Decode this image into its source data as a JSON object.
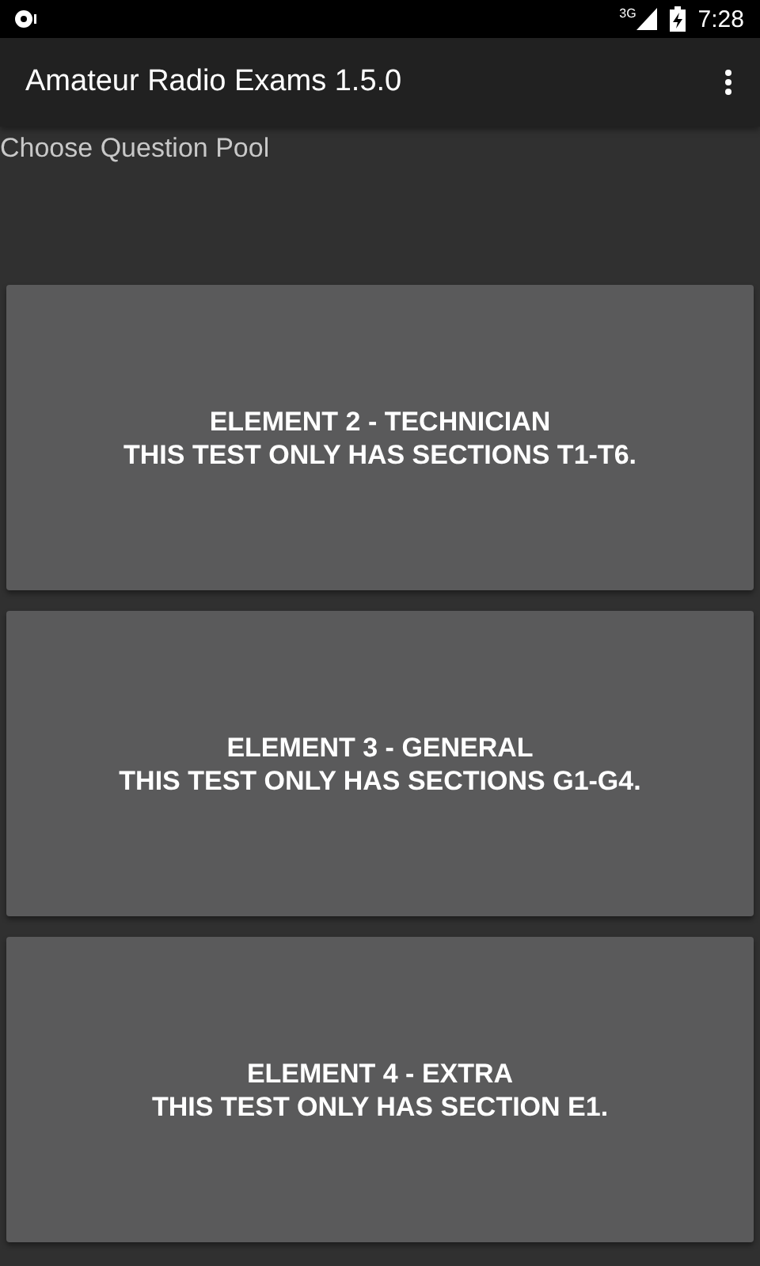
{
  "status_bar": {
    "network": "3G",
    "time": "7:28"
  },
  "app_bar": {
    "title": "Amateur Radio Exams 1.5.0"
  },
  "subheader": "Choose Question Pool",
  "pools": [
    {
      "title": "ELEMENT 2 - TECHNICIAN",
      "note": "THIS TEST ONLY HAS SECTIONS T1-T6."
    },
    {
      "title": "ELEMENT 3 - GENERAL",
      "note": "THIS TEST ONLY HAS SECTIONS G1-G4."
    },
    {
      "title": "ELEMENT 4 - EXTRA",
      "note": "THIS TEST ONLY HAS SECTION E1."
    }
  ]
}
